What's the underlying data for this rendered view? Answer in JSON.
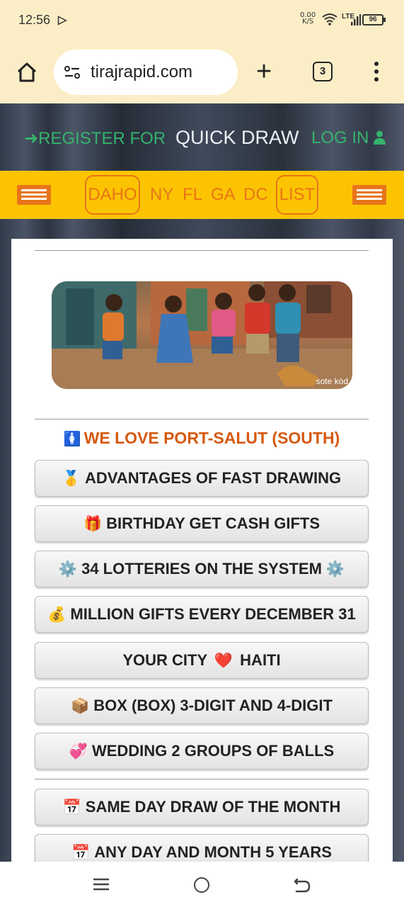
{
  "status": {
    "time": "12:56",
    "notification_icon": "play-notif-icon",
    "speed_top": "0.00",
    "speed_bottom": "K/S",
    "network": "LTE",
    "battery": "96"
  },
  "browser": {
    "url": "tirajrapid.com",
    "tab_count": "3"
  },
  "header": {
    "register": "REGISTER FOR",
    "title": "QUICK DRAW",
    "login": "LOG IN"
  },
  "nav": {
    "active": "DAHO",
    "items": [
      "NY",
      "FL",
      "GA",
      "DC"
    ],
    "list": "LIST"
  },
  "banner": {
    "caption": "sote kòd"
  },
  "love": {
    "text": "WE LOVE PORT-SALUT (SOUTH)"
  },
  "buttons": [
    {
      "emoji": "🥇",
      "label": "ADVANTAGES OF FAST DRAWING"
    },
    {
      "emoji": "🎁",
      "label": "BIRTHDAY GET CASH GIFTS"
    },
    {
      "emoji": "⚙️",
      "label": "34 LOTTERIES ON THE SYSTEM",
      "emoji_after": "⚙️"
    },
    {
      "emoji": "💰",
      "label": "MILLION GIFTS EVERY DECEMBER 31"
    },
    {
      "label": "YOUR CITY",
      "emoji_mid": "❤️",
      "label_after": "HAITI"
    },
    {
      "emoji": "📦",
      "label": "BOX (BOX) 3-DIGIT AND 4-DIGIT"
    },
    {
      "emoji": "💞",
      "label": "WEDDING 2 GROUPS OF BALLS"
    },
    {
      "emoji": "📅",
      "label": "SAME DAY DRAW OF THE MONTH"
    },
    {
      "emoji": "📅",
      "label": "ANY DAY AND MONTH 5 YEARS"
    }
  ]
}
